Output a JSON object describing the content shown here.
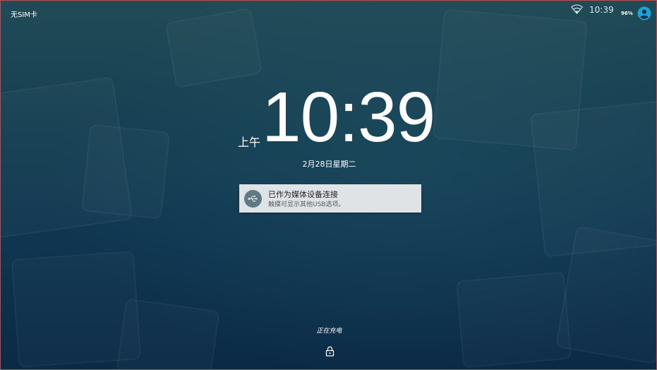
{
  "status_bar": {
    "carrier": "无SIM卡",
    "time": "10:39",
    "battery": "96%",
    "wifi_icon": "wifi-icon",
    "user_icon": "account-circle-icon"
  },
  "lockscreen": {
    "ampm": "上午",
    "clock": "10:39",
    "date": "2月28日星期二",
    "charging": "正在充电",
    "lock_icon": "lock-icon"
  },
  "notification": {
    "icon": "usb-icon",
    "title": "已作为媒体设备连接",
    "text": "触摸可显示其他USB选项。"
  },
  "colors": {
    "accent": "#1ea0d8",
    "notification_bg": "#dfe3e6",
    "notification_icon_bg": "#5f7a84"
  }
}
